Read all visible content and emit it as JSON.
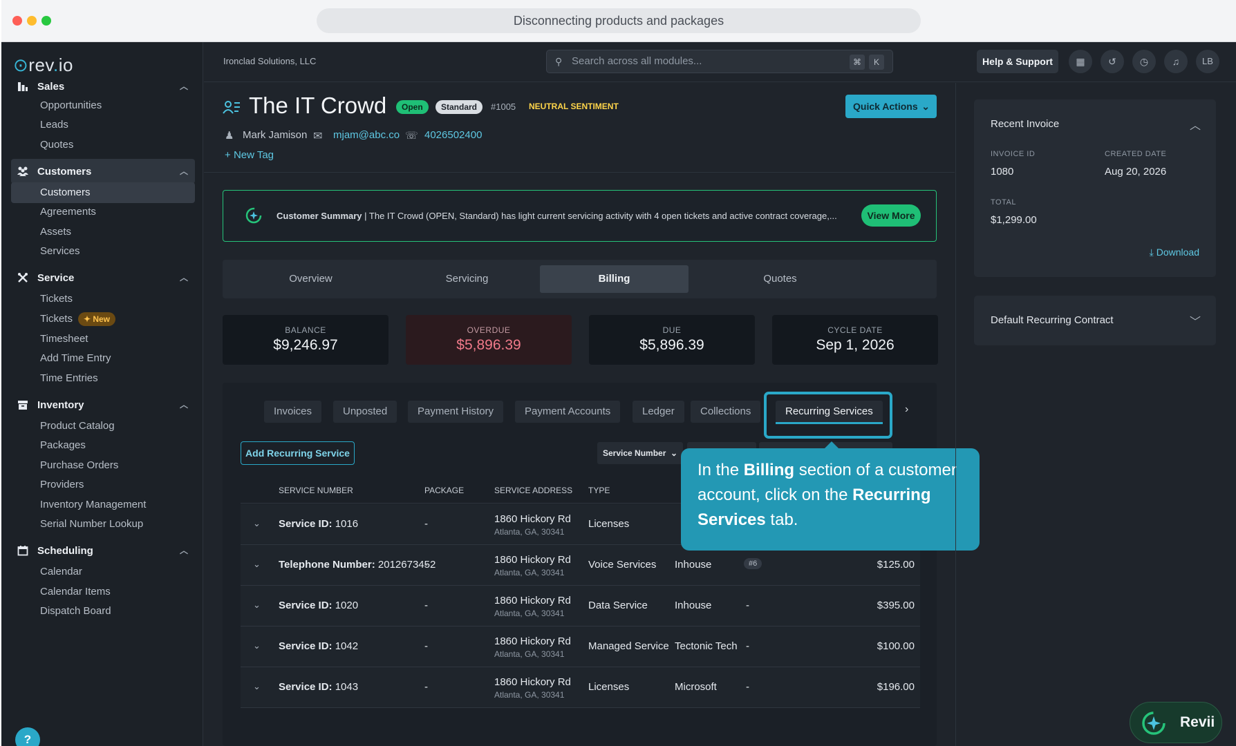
{
  "window": {
    "url_title": "Disconnecting products and packages"
  },
  "sidebar": {
    "logo_prefix": "rev",
    "logo_dot": ".",
    "logo_suffix": "io",
    "sections": [
      {
        "label": "Sales",
        "icon": "bar-chart-icon",
        "items": [
          "Opportunities",
          "Leads",
          "Quotes"
        ]
      },
      {
        "label": "Customers",
        "icon": "people-icon",
        "items": [
          "Customers",
          "Agreements",
          "Assets",
          "Services"
        ]
      },
      {
        "label": "Service",
        "icon": "tools-icon",
        "items": [
          "Tickets",
          "Tickets",
          "Timesheet",
          "Add Time Entry",
          "Time Entries"
        ]
      },
      {
        "label": "Inventory",
        "icon": "archive-icon",
        "items": [
          "Product Catalog",
          "Packages",
          "Purchase Orders",
          "Providers",
          "Inventory Management",
          "Serial Number Lookup"
        ]
      },
      {
        "label": "Scheduling",
        "icon": "calendar-icon",
        "items": [
          "Calendar",
          "Calendar Items",
          "Dispatch Board"
        ]
      }
    ],
    "new_badge": "New",
    "help_glyph": "?"
  },
  "topbar": {
    "company": "Ironclad Solutions, LLC",
    "search_placeholder": "Search across all modules...",
    "kbd_cmd": "⌘",
    "kbd_k": "K",
    "help_label": "Help & Support",
    "avatar_initials": "LB"
  },
  "customer": {
    "name": "The IT Crowd",
    "status": "Open",
    "tier": "Standard",
    "number": "#1005",
    "sentiment": "NEUTRAL SENTIMENT",
    "contact_name": "Mark Jamison",
    "email": "mjam@abc.co",
    "phone": "4026502400",
    "new_tag": "New Tag",
    "quick_actions": "Quick Actions"
  },
  "summary": {
    "label": "Customer Summary",
    "text": " | The IT Crowd (OPEN, Standard) has light current servicing activity with 4 open tickets and active contract coverage,...",
    "view_more": "View More"
  },
  "tabs": [
    "Overview",
    "Servicing",
    "Billing",
    "Quotes"
  ],
  "active_tab": "Billing",
  "cards": [
    {
      "label": "BALANCE",
      "value": "$9,246.97"
    },
    {
      "label": "OVERDUE",
      "value": "$5,896.39"
    },
    {
      "label": "DUE",
      "value": "$5,896.39"
    },
    {
      "label": "CYCLE DATE",
      "value": "Sep 1, 2026"
    }
  ],
  "billing_tabs": [
    "Invoices",
    "Unposted",
    "Payment History",
    "Payment Accounts",
    "Ledger",
    "Collections",
    "Recurring Services"
  ],
  "active_billing_tab": "Recurring Services",
  "add_recurring": "Add Recurring Service",
  "service_number_filter": "Service Number",
  "table": {
    "headers": [
      "SERVICE NUMBER",
      "PACKAGE",
      "SERVICE ADDRESS",
      "TYPE"
    ],
    "rows": [
      {
        "id_label": "Service ID:",
        "id": "1016",
        "package": "-",
        "addr1": "1860 Hickory Rd",
        "addr2": "Atlanta, GA, 30341",
        "type": "Licenses",
        "provider": "",
        "qty": "",
        "amount": ""
      },
      {
        "id_label": "Telephone Number:",
        "id": "2012673452",
        "package": "-",
        "addr1": "1860 Hickory Rd",
        "addr2": "Atlanta, GA, 30341",
        "type": "Voice Services",
        "provider": "Inhouse",
        "qty": "#6",
        "amount": "$125.00"
      },
      {
        "id_label": "Service ID:",
        "id": "1020",
        "package": "-",
        "addr1": "1860 Hickory Rd",
        "addr2": "Atlanta, GA, 30341",
        "type": "Data Service",
        "provider": "Inhouse",
        "qty": "-",
        "amount": "$395.00"
      },
      {
        "id_label": "Service ID:",
        "id": "1042",
        "package": "-",
        "addr1": "1860 Hickory Rd",
        "addr2": "Atlanta, GA, 30341",
        "type": "Managed Service",
        "provider": "Tectonic Tech",
        "qty": "-",
        "amount": "$100.00"
      },
      {
        "id_label": "Service ID:",
        "id": "1043",
        "package": "-",
        "addr1": "1860 Hickory Rd",
        "addr2": "Atlanta, GA, 30341",
        "type": "Licenses",
        "provider": "Microsoft",
        "qty": "-",
        "amount": "$196.00"
      }
    ]
  },
  "tooltip": {
    "part1": "In the ",
    "bold1": "Billing",
    "part2": " section of a customer account, click on the ",
    "bold2": "Recurring Services",
    "part3": " tab."
  },
  "recent_invoice": {
    "title": "Recent Invoice",
    "invoice_id_label": "INVOICE ID",
    "invoice_id": "1080",
    "created_label": "CREATED DATE",
    "created": "Aug 20, 2026",
    "total_label": "TOTAL",
    "total": "$1,299.00",
    "download": "Download"
  },
  "default_contract": {
    "title": "Default Recurring Contract"
  },
  "revii": {
    "label": "Revii"
  },
  "colors": {
    "accent": "#2aa8c8",
    "success": "#1fbf76",
    "danger": "#f07a8a",
    "warning": "#ffd54a"
  }
}
